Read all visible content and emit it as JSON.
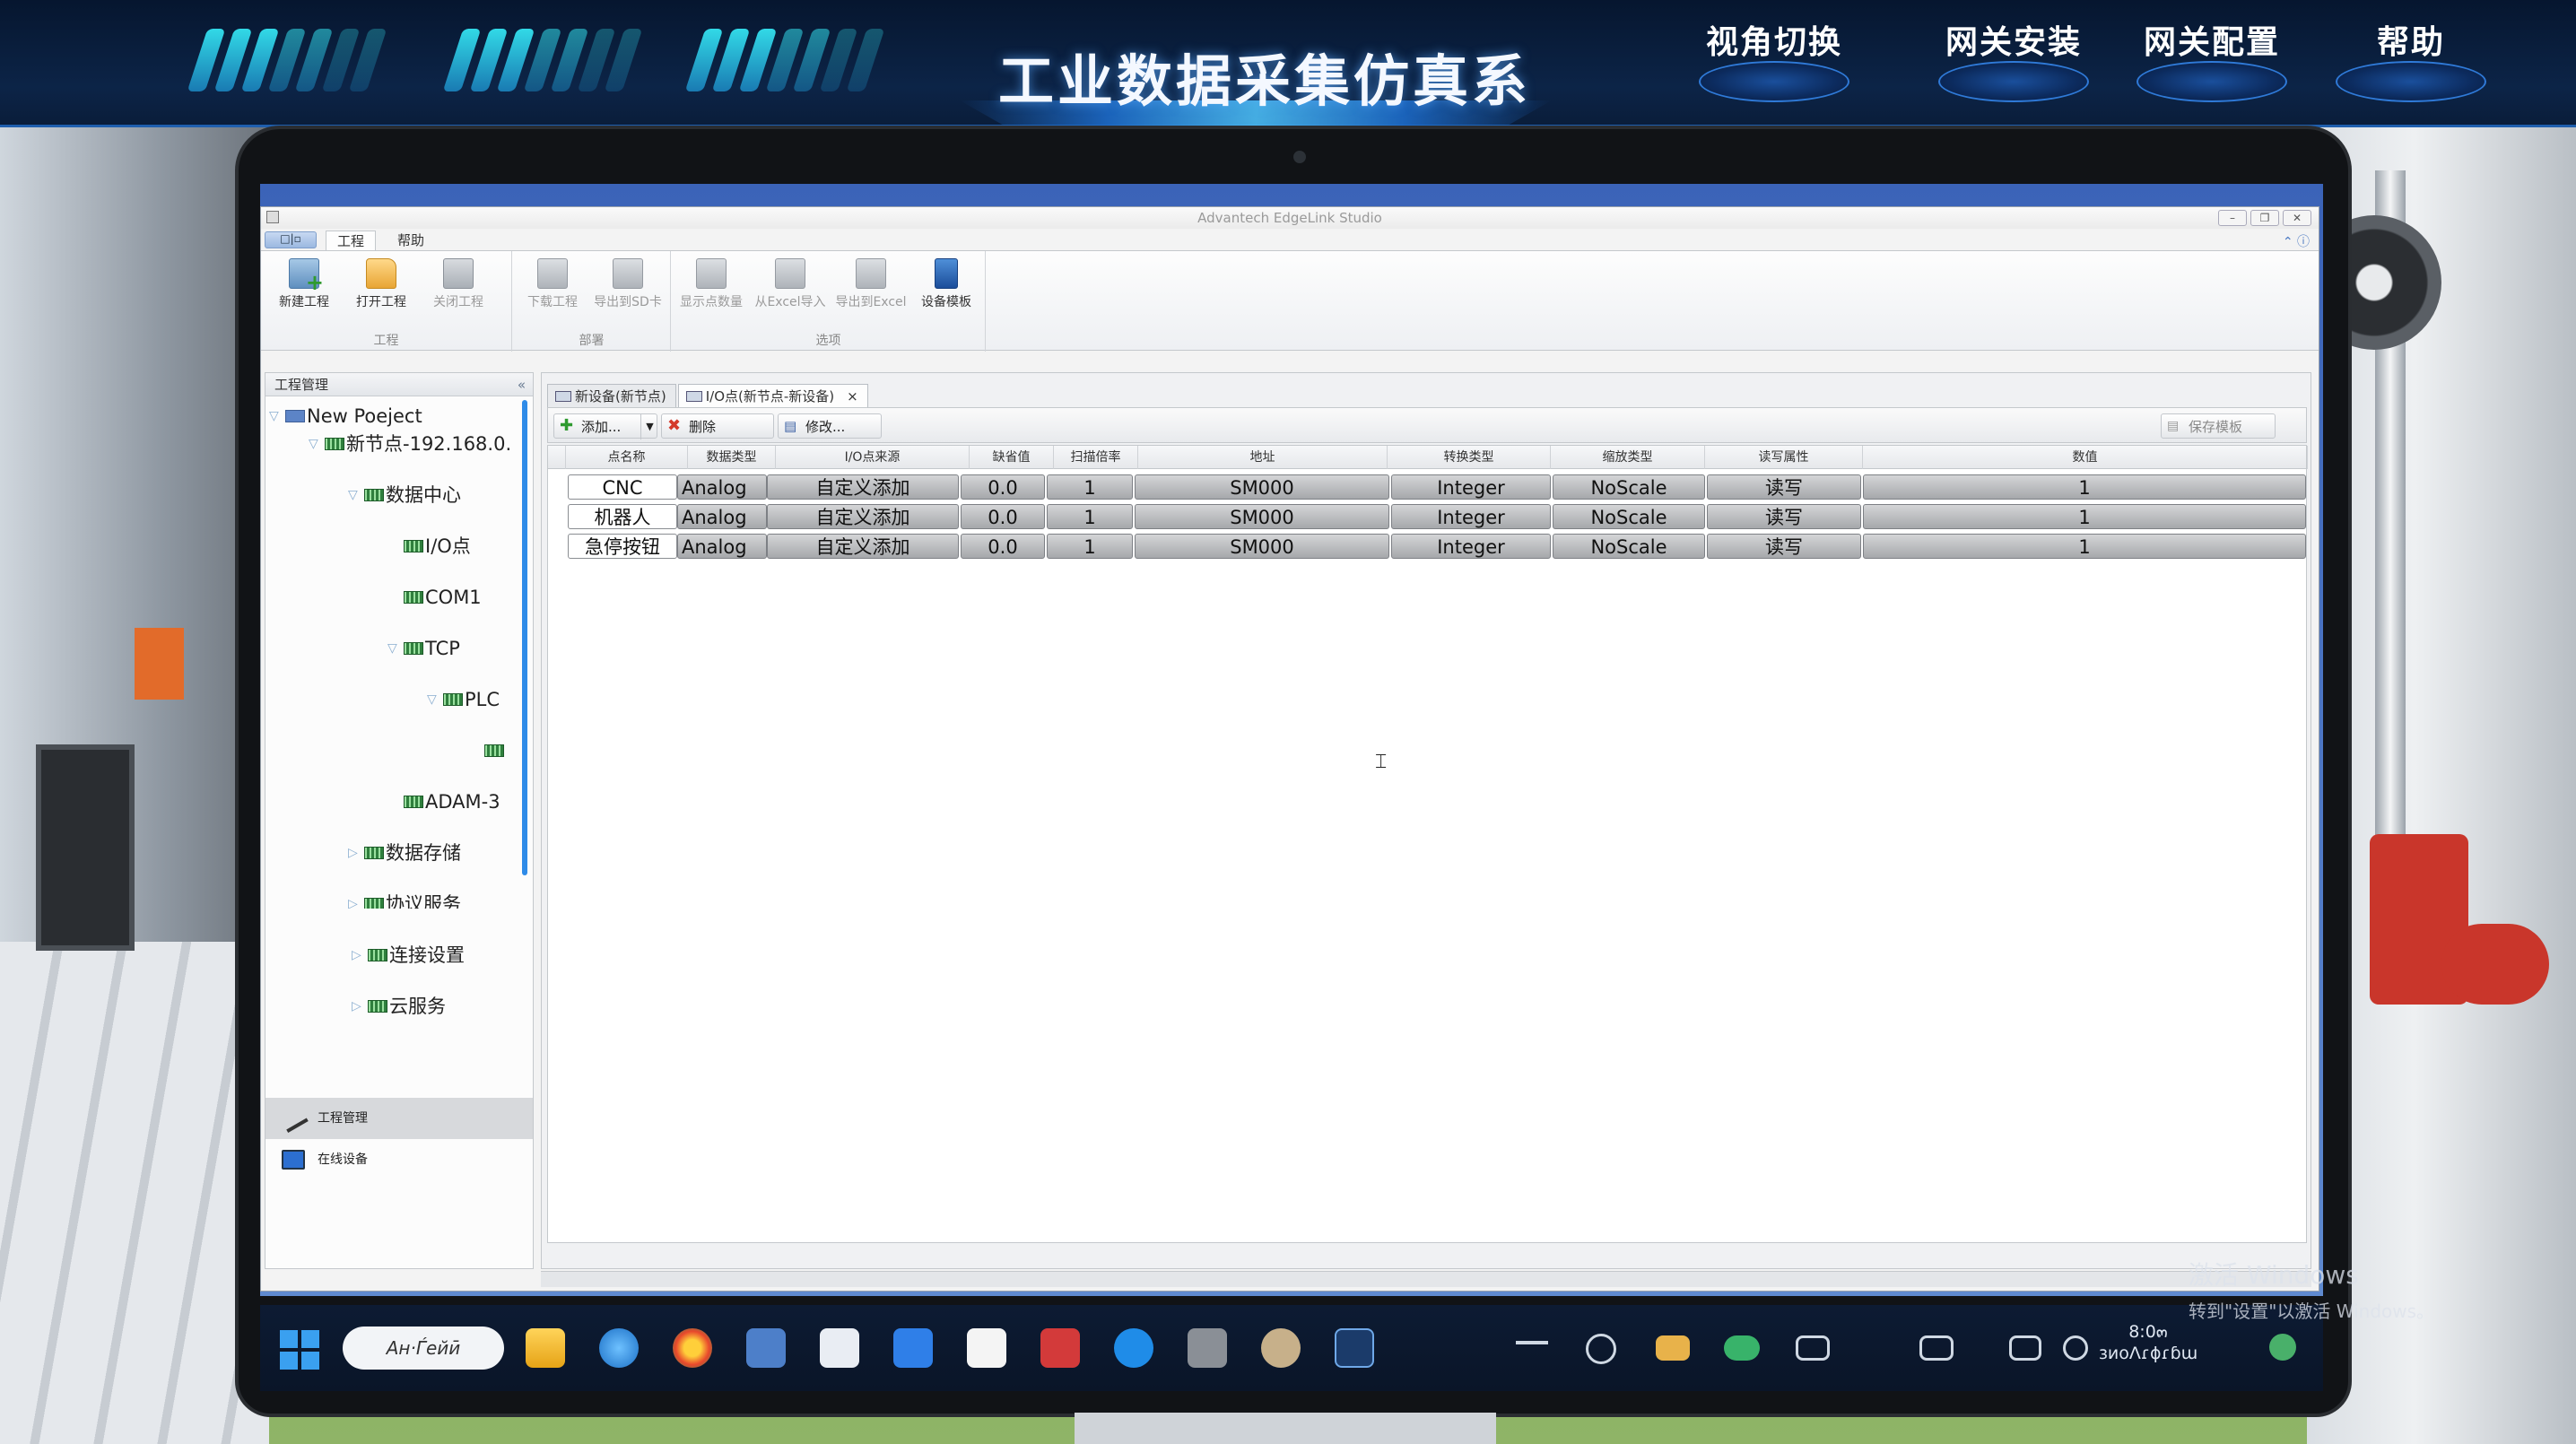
{
  "banner": {
    "title": "工业数据采集仿真系统",
    "nav": [
      "视角切换",
      "网关安装",
      "网关配置",
      "帮助"
    ]
  },
  "app": {
    "window_title": "Advantech EdgeLink Studio",
    "app_button": "□|▫",
    "ribbon_tabs": [
      "工程",
      "帮助"
    ],
    "ribbon_groups": [
      {
        "label": "工程",
        "buttons": [
          "新建工程",
          "打开工程",
          "关闭工程"
        ]
      },
      {
        "label": "部署",
        "buttons": [
          "下载工程",
          "导出到SD卡"
        ]
      },
      {
        "label": "选项",
        "buttons": [
          "显示点数量",
          "从Excel导入",
          "导出到Excel",
          "设备模板"
        ]
      }
    ]
  },
  "left_panel": {
    "title": "工程管理",
    "collapse": "«",
    "tree": [
      {
        "label": "New Poeject",
        "icon": "pc"
      },
      {
        "label": "新节点-192.168.0.",
        "icon": "module"
      },
      {
        "label": "数据中心",
        "icon": "module"
      },
      {
        "label": "I/O点",
        "icon": "module"
      },
      {
        "label": "COM1",
        "icon": "module"
      },
      {
        "label": "TCP",
        "icon": "module"
      },
      {
        "label": "PLC",
        "icon": "module"
      },
      {
        "label": "",
        "icon": "module"
      },
      {
        "label": "ADAM-3",
        "icon": "module"
      },
      {
        "label": "数据存储",
        "icon": "module"
      },
      {
        "label": "协议服务",
        "icon": "module"
      },
      {
        "label": "连接设置",
        "icon": "module"
      },
      {
        "label": "云服务",
        "icon": "module"
      }
    ],
    "bottom_buttons": [
      "工程管理",
      "在线设备"
    ]
  },
  "main_panel": {
    "tabs": [
      {
        "label": "新设备(新节点)"
      },
      {
        "label": "I/O点(新节点-新设备)",
        "close": "×"
      }
    ],
    "toolbar": {
      "add": "添加...",
      "delete": "删除",
      "edit": "修改...",
      "save_template": "保存模板",
      "add_icon": "plus-icon",
      "delete_icon": "x-icon"
    },
    "grid": {
      "columns": [
        "点名称",
        "数据类型",
        "I/O点来源",
        "缺省值",
        "扫描倍率",
        "地址",
        "转换类型",
        "缩放类型",
        "读写属性",
        "数值"
      ],
      "rows": [
        [
          "CNC",
          "Analog",
          "自定义添加",
          "0.0",
          "1",
          "SM000",
          "Integer",
          "NoScale",
          "读写",
          "1"
        ],
        [
          "机器人",
          "Analog",
          "自定义添加",
          "0.0",
          "1",
          "SM000",
          "Integer",
          "NoScale",
          "读写",
          "1"
        ],
        [
          "急停按钮",
          "Analog",
          "自定义添加",
          "0.0",
          "1",
          "SM000",
          "Integer",
          "NoScale",
          "读写",
          "1"
        ]
      ]
    }
  },
  "taskbar": {
    "search": "Ан·Ѓейӣ",
    "tray_line1": "8:0๓",
    "tray_line2": "ɜиоɅɾɸɾɓɯ"
  },
  "watermark": {
    "line1": "激活 Windows",
    "line2": "转到\"设置\"以激活 Windows。"
  }
}
